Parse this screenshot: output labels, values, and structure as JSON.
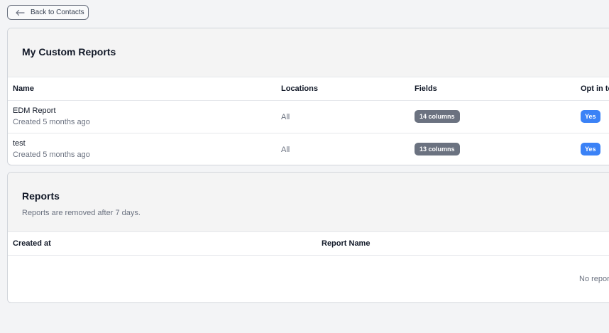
{
  "back_button": {
    "label": "Back to Contacts",
    "icon": "arrow-left-icon"
  },
  "custom_reports": {
    "title": "My Custom Reports",
    "columns": [
      "Name",
      "Locations",
      "Fields",
      "Opt in to"
    ],
    "rows": [
      {
        "name": "EDM Report",
        "created": "Created 5 months ago",
        "locations": "All",
        "fields": "14 columns",
        "opt_in": "Yes"
      },
      {
        "name": "test",
        "created": "Created 5 months ago",
        "locations": "All",
        "fields": "13 columns",
        "opt_in": "Yes"
      }
    ]
  },
  "reports": {
    "title": "Reports",
    "subtitle": "Reports are removed after 7 days.",
    "columns": [
      "Created at",
      "Report Name"
    ],
    "empty_text": "No reports"
  }
}
